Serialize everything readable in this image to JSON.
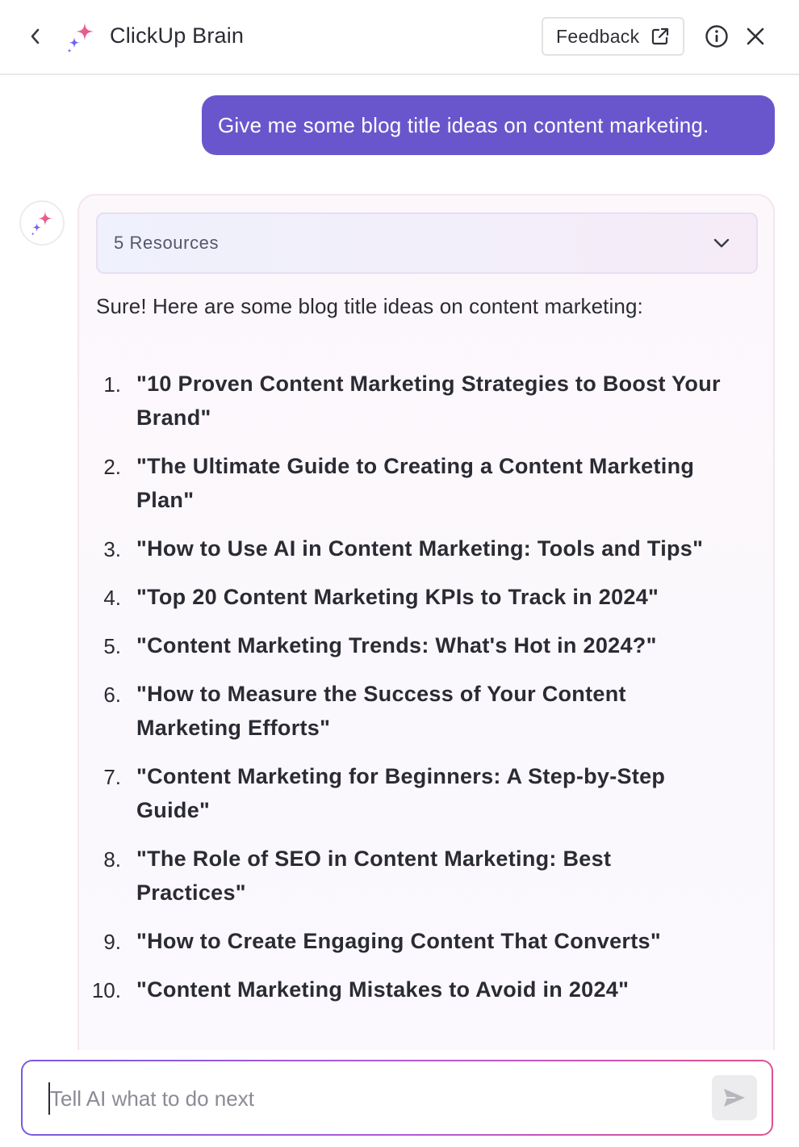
{
  "header": {
    "title": "ClickUp Brain",
    "feedback_label": "Feedback",
    "icons": {
      "back": "chevron-left-icon",
      "logo": "sparkle-icon",
      "external": "external-link-icon",
      "info": "info-icon",
      "close": "close-icon"
    }
  },
  "conversation": {
    "user_message": "Give me some blog title ideas on content marketing.",
    "response": {
      "resources_label": "5 Resources",
      "intro": "Sure! Here are some blog title ideas on content marketing:",
      "items": [
        {
          "num": "1.",
          "text": "\"10 Proven Content Marketing Strategies to Boost Your Brand\""
        },
        {
          "num": "2.",
          "text": "\"The Ultimate Guide to Creating a Content Marketing Plan\""
        },
        {
          "num": "3.",
          "text": "\"How to Use AI in Content Marketing: Tools and Tips\""
        },
        {
          "num": "4.",
          "text": "\"Top 20 Content Marketing KPIs to Track in 2024\""
        },
        {
          "num": "5.",
          "text": "\"Content Marketing Trends: What's Hot in 2024?\""
        },
        {
          "num": "6.",
          "text": "\"How to Measure the Success of Your Content Marketing Efforts\""
        },
        {
          "num": "7.",
          "text": "\"Content Marketing for Beginners: A Step-by-Step Guide\""
        },
        {
          "num": "8.",
          "text": "\"The Role of SEO in Content Marketing: Best Practices\""
        },
        {
          "num": "9.",
          "text": "\"How to Create Engaging Content That Converts\""
        },
        {
          "num": "10.",
          "text": "\"Content Marketing Mistakes to Avoid in 2024\""
        }
      ]
    }
  },
  "composer": {
    "placeholder": "Tell AI what to do next",
    "value": ""
  },
  "colors": {
    "user_bubble": "#6a56cc",
    "accent_pink": "#e84a8a",
    "accent_purple": "#7b5cf0"
  }
}
